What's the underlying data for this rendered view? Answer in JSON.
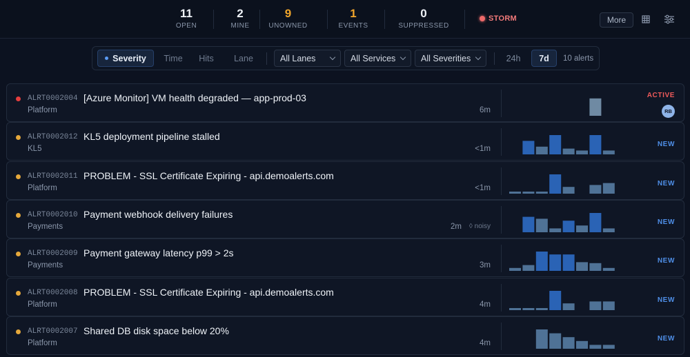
{
  "stats": [
    {
      "value": "11",
      "label": "OPEN"
    },
    {
      "value": "2",
      "label": "MINE"
    },
    {
      "value": "9",
      "label": "UNOWNED"
    },
    {
      "value": "1",
      "label": "EVENTS"
    },
    {
      "value": "0",
      "label": "SUPPRESSED"
    }
  ],
  "storm_label": "STORM",
  "more_label": "More",
  "filter": {
    "sort_tabs": [
      "Severity",
      "Time",
      "Hits",
      "Lane"
    ],
    "lanes": "All Lanes",
    "services": "All Services",
    "severities": "All Severities",
    "ranges": [
      "24h",
      "7d"
    ],
    "count": "10 alerts"
  },
  "colors": {
    "critical": "#e53e3e",
    "warning": "#e5a83b",
    "bar_highlight": "#2a63b5",
    "bar_muted": "#4f7296",
    "bar_grey": "#6f8aa3"
  },
  "alerts": [
    {
      "id": "ALRT0002004",
      "title": "[Azure Monitor] VM health degraded — app-prod-03",
      "team": "Platform",
      "age": "6m",
      "noisy": "",
      "status": "ACTIVE",
      "severity": "critical",
      "avatar": "RB",
      "bars": [
        0,
        0,
        0,
        0,
        0,
        0,
        0.9,
        0
      ],
      "hl": [],
      "grey": true
    },
    {
      "id": "ALRT0002012",
      "title": "KL5 deployment pipeline stalled",
      "team": "KL5",
      "age": "<1m",
      "noisy": "",
      "status": "NEW",
      "severity": "warning",
      "avatar": "",
      "bars": [
        0,
        0.7,
        0.4,
        1,
        0.3,
        0.2,
        1,
        0.2
      ],
      "hl": [
        1,
        3,
        6
      ],
      "grey": false
    },
    {
      "id": "ALRT0002011",
      "title": "PROBLEM - SSL Certificate Expiring - api.demoalerts.com",
      "team": "Platform",
      "age": "<1m",
      "noisy": "",
      "status": "NEW",
      "severity": "warning",
      "avatar": "",
      "bars": [
        0.1,
        0.1,
        0.1,
        1,
        0.35,
        0,
        0.45,
        0.55
      ],
      "hl": [
        3
      ],
      "grey": false
    },
    {
      "id": "ALRT0002010",
      "title": "Payment webhook delivery failures",
      "team": "Payments",
      "age": "2m",
      "noisy": "◊ noisy",
      "status": "NEW",
      "severity": "warning",
      "avatar": "",
      "bars": [
        0,
        0.8,
        0.7,
        0.2,
        0.6,
        0.35,
        1,
        0.2
      ],
      "hl": [
        1,
        4,
        6
      ],
      "grey": false
    },
    {
      "id": "ALRT0002009",
      "title": "Payment gateway latency p99 > 2s",
      "team": "Payments",
      "age": "3m",
      "noisy": "",
      "status": "NEW",
      "severity": "warning",
      "avatar": "",
      "bars": [
        0.15,
        0.3,
        1,
        0.85,
        0.85,
        0.45,
        0.4,
        0.15
      ],
      "hl": [
        2,
        3,
        4
      ],
      "grey": false
    },
    {
      "id": "ALRT0002008",
      "title": "PROBLEM - SSL Certificate Expiring - api.demoalerts.com",
      "team": "Platform",
      "age": "4m",
      "noisy": "",
      "status": "NEW",
      "severity": "warning",
      "avatar": "",
      "bars": [
        0.1,
        0.1,
        0.1,
        1,
        0.35,
        0,
        0.45,
        0.45
      ],
      "hl": [
        3
      ],
      "grey": false
    },
    {
      "id": "ALRT0002007",
      "title": "Shared DB disk space below 20%",
      "team": "Platform",
      "age": "4m",
      "noisy": "",
      "status": "NEW",
      "severity": "warning",
      "avatar": "",
      "bars": [
        0,
        0,
        1,
        0.8,
        0.6,
        0.4,
        0.2,
        0.2
      ],
      "hl": [],
      "grey": false
    }
  ]
}
